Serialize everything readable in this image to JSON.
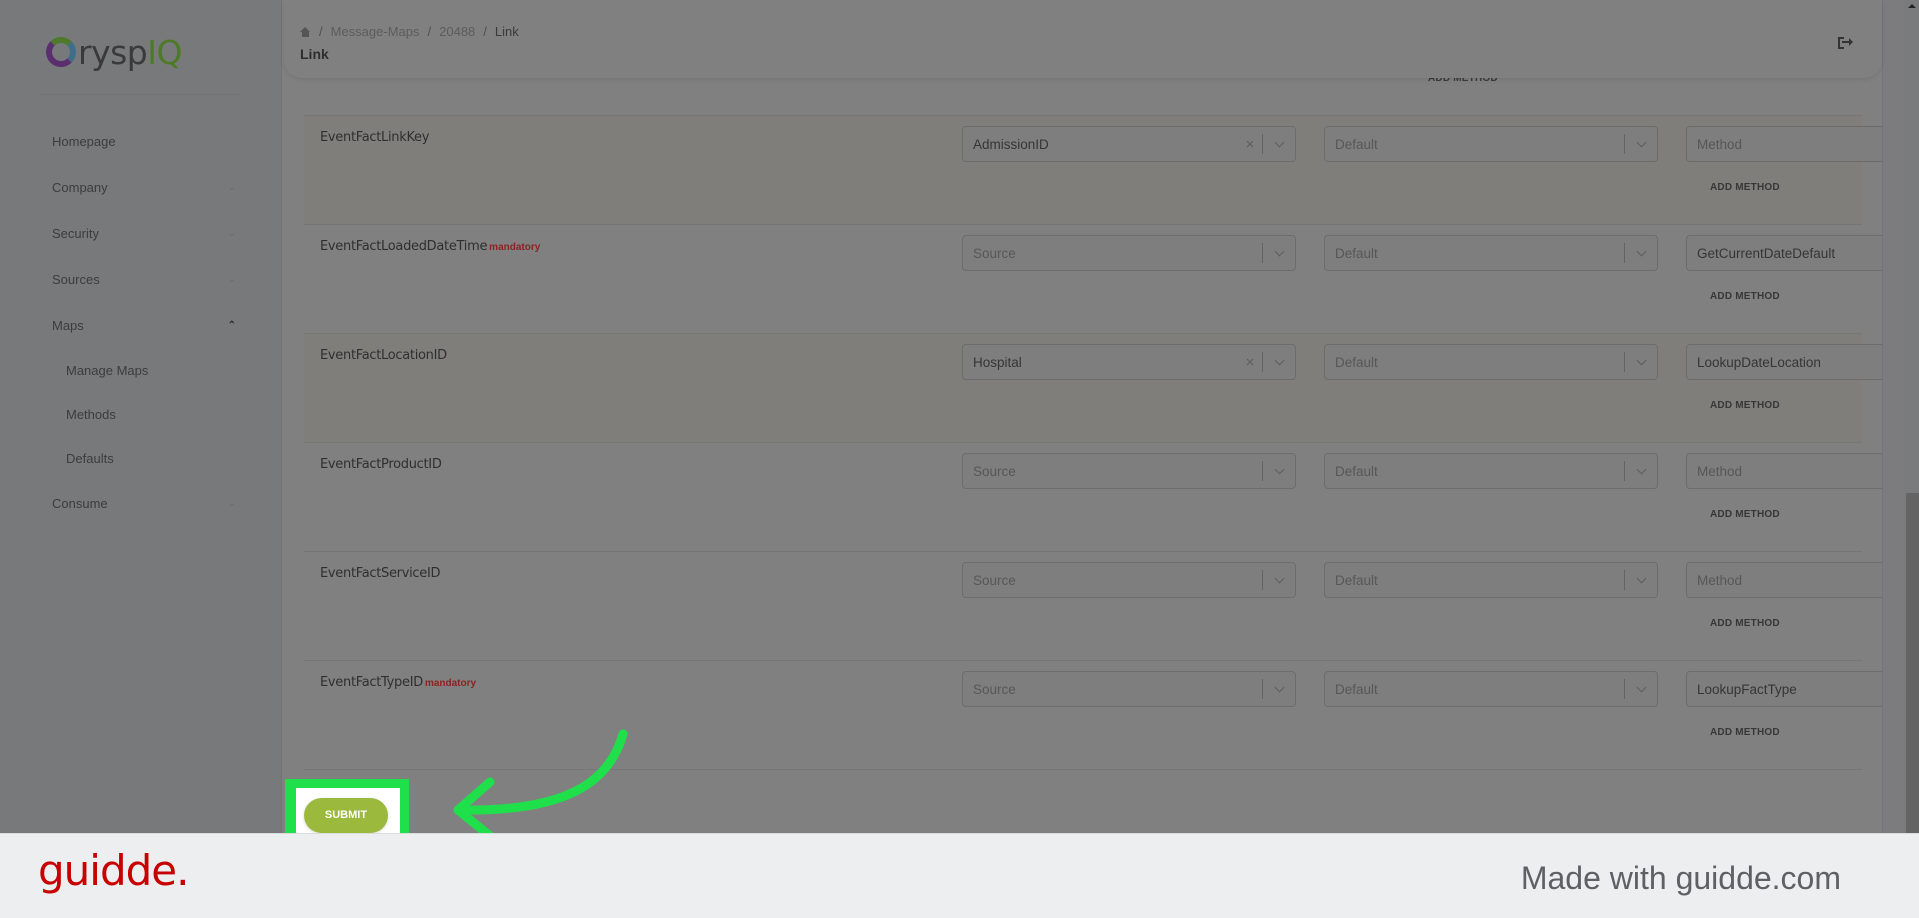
{
  "app": {
    "logo_prefix": "rysp",
    "logo_suffix": "IQ",
    "brand_color": "#4e7a26"
  },
  "sidebar": {
    "items": [
      {
        "label": "Homepage",
        "expandable": false
      },
      {
        "label": "Company",
        "expandable": true,
        "expanded": false
      },
      {
        "label": "Security",
        "expandable": true,
        "expanded": false
      },
      {
        "label": "Sources",
        "expandable": true,
        "expanded": false
      },
      {
        "label": "Maps",
        "expandable": true,
        "expanded": true
      },
      {
        "label": "Manage Maps",
        "sub": true
      },
      {
        "label": "Methods",
        "sub": true
      },
      {
        "label": "Defaults",
        "sub": true
      },
      {
        "label": "Consume",
        "expandable": true,
        "expanded": false
      }
    ]
  },
  "header": {
    "breadcrumb": [
      "Message-Maps",
      "20488",
      "Link"
    ],
    "separator": "/",
    "title": "Link"
  },
  "labels": {
    "add_method": "ADD METHOD",
    "mandatory": "mandatory",
    "remove": "×",
    "clear": "×",
    "submit": "SUBMIT"
  },
  "rows": [
    {
      "field": "EventFactLinkKey",
      "mandatory": false,
      "source": "AdmissionID",
      "source_placeholder": "Source",
      "default": "",
      "default_placeholder": "Default",
      "method": "",
      "method_placeholder": "Method",
      "toggle": "off",
      "highlight": true
    },
    {
      "field": "EventFactLoadedDateTime",
      "mandatory": true,
      "source": "",
      "source_placeholder": "Source",
      "default": "",
      "default_placeholder": "Default",
      "method": "GetCurrentDateDefault",
      "method_placeholder": "Method",
      "toggle": "on",
      "highlight": false
    },
    {
      "field": "EventFactLocationID",
      "mandatory": false,
      "source": "Hospital",
      "source_placeholder": "Source",
      "default": "",
      "default_placeholder": "Default",
      "method": "LookupDateLocation",
      "method_placeholder": "Method",
      "toggle": "off",
      "highlight": true
    },
    {
      "field": "EventFactProductID",
      "mandatory": false,
      "source": "",
      "source_placeholder": "Source",
      "default": "",
      "default_placeholder": "Default",
      "method": "",
      "method_placeholder": "Method",
      "toggle": "disabled",
      "highlight": false
    },
    {
      "field": "EventFactServiceID",
      "mandatory": false,
      "source": "",
      "source_placeholder": "Source",
      "default": "",
      "default_placeholder": "Default",
      "method": "",
      "method_placeholder": "Method",
      "toggle": "disabled",
      "highlight": false
    },
    {
      "field": "EventFactTypeID",
      "mandatory": true,
      "source": "",
      "source_placeholder": "Source",
      "default": "",
      "default_placeholder": "Default",
      "method": "LookupFactType",
      "method_placeholder": "Method",
      "toggle": "on",
      "highlight": false
    }
  ],
  "colors": {
    "mandatory": "#8c2222",
    "remove": "#b01818",
    "submit": "#9ab93d",
    "highlight_frame": "#1fe04a"
  },
  "footer": {
    "logo": "guidde.",
    "made_with": "Made with guidde.com"
  }
}
